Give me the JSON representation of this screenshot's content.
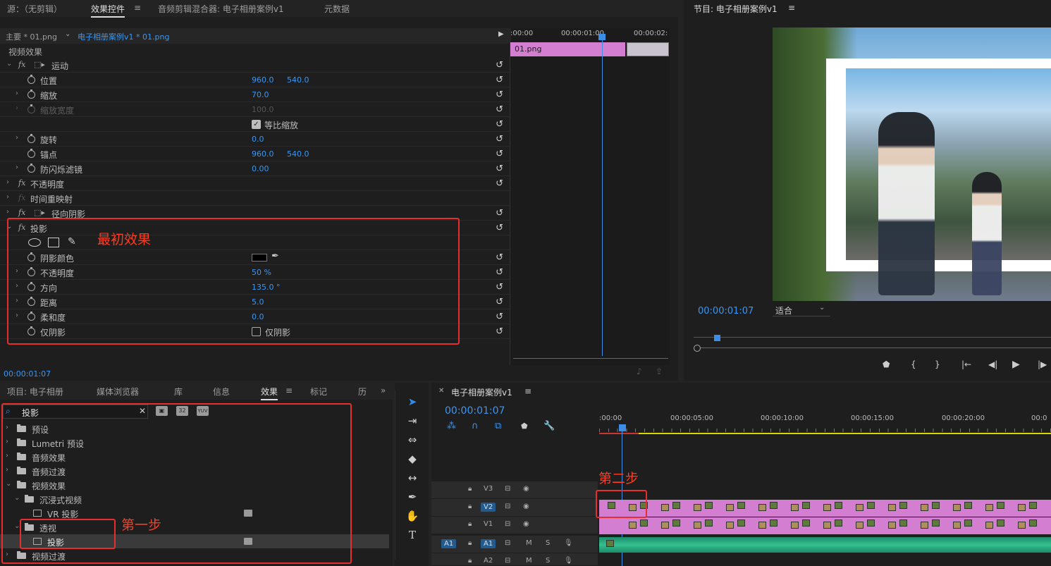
{
  "effect_controls": {
    "tabs": [
      "源：（无剪辑）",
      "效果控件",
      "音频剪辑混合器: 电子相册案例v1",
      "元数据"
    ],
    "active_tab": "效果控件",
    "menu_icon": "≡",
    "master_label": "主要 * 01.png",
    "clip_label": "电子相册案例v1 * 01.png",
    "section_label": "视频效果",
    "rows": {
      "motion": "运动",
      "position": {
        "label": "位置",
        "v1": "960.0",
        "v2": "540.0"
      },
      "scale": {
        "label": "缩放",
        "v1": "70.0"
      },
      "scale_width": {
        "label": "缩放宽度",
        "v1": "100.0"
      },
      "uniform_scale": "等比缩放",
      "rotation": {
        "label": "旋转",
        "v1": "0.0"
      },
      "anchor": {
        "label": "锚点",
        "v1": "960.0",
        "v2": "540.0"
      },
      "antiflicker": {
        "label": "防闪烁滤镜",
        "v1": "0.00"
      },
      "opacity": "不透明度",
      "time_remap": "时间重映射",
      "radial_shadow": "径向阴影",
      "drop_shadow": "投影",
      "shadow_color": "阴影颜色",
      "ds_opacity": {
        "label": "不透明度",
        "v1": "50 %"
      },
      "direction": {
        "label": "方向",
        "v1": "135.0 °"
      },
      "distance": {
        "label": "距离",
        "v1": "5.0"
      },
      "softness": {
        "label": "柔和度",
        "v1": "0.0"
      },
      "shadow_only": {
        "label": "仅阴影",
        "checkbox": "仅阴影"
      }
    },
    "timecode": "00:00:01:07",
    "mini_timeline": {
      "times": [
        ":00:00",
        "00:00:01:00",
        "00:00:02:"
      ],
      "clip": "01.png"
    }
  },
  "program_monitor": {
    "title": "节目: 电子相册案例v1",
    "menu_icon": "≡",
    "timecode": "00:00:01:07",
    "fit": "适合"
  },
  "project_panel": {
    "tabs": [
      "项目: 电子相册",
      "媒体浏览器",
      "库",
      "信息",
      "效果",
      "标记",
      "历"
    ],
    "active_tab": "效果",
    "search_value": "投影",
    "search_icons": [
      "32",
      "YUV"
    ],
    "items": [
      {
        "label": "预设"
      },
      {
        "label": "Lumetri 预设"
      },
      {
        "label": "音频效果"
      },
      {
        "label": "音频过渡"
      },
      {
        "label": "视频效果"
      },
      {
        "label": "沉浸式视频"
      },
      {
        "label": "VR 投影"
      },
      {
        "label": "透视"
      },
      {
        "label": "投影"
      },
      {
        "label": "视频过渡"
      }
    ]
  },
  "timeline": {
    "title": "电子相册案例v1",
    "menu_icon": "≡",
    "timecode": "00:00:01:07",
    "ruler": [
      ":00:00",
      "00:00:05:00",
      "00:00:10:00",
      "00:00:15:00",
      "00:00:20:00",
      "00:0"
    ],
    "tracks": [
      {
        "name": "V3"
      },
      {
        "name": "V2"
      },
      {
        "name": "V1"
      },
      {
        "name": "A1",
        "src": "A1"
      },
      {
        "name": "A2"
      }
    ],
    "track_buttons": {
      "mute": "M",
      "solo": "S"
    }
  },
  "annotations": {
    "initial_effect": "最初效果",
    "step1": "第一步",
    "step2": "第二步"
  }
}
